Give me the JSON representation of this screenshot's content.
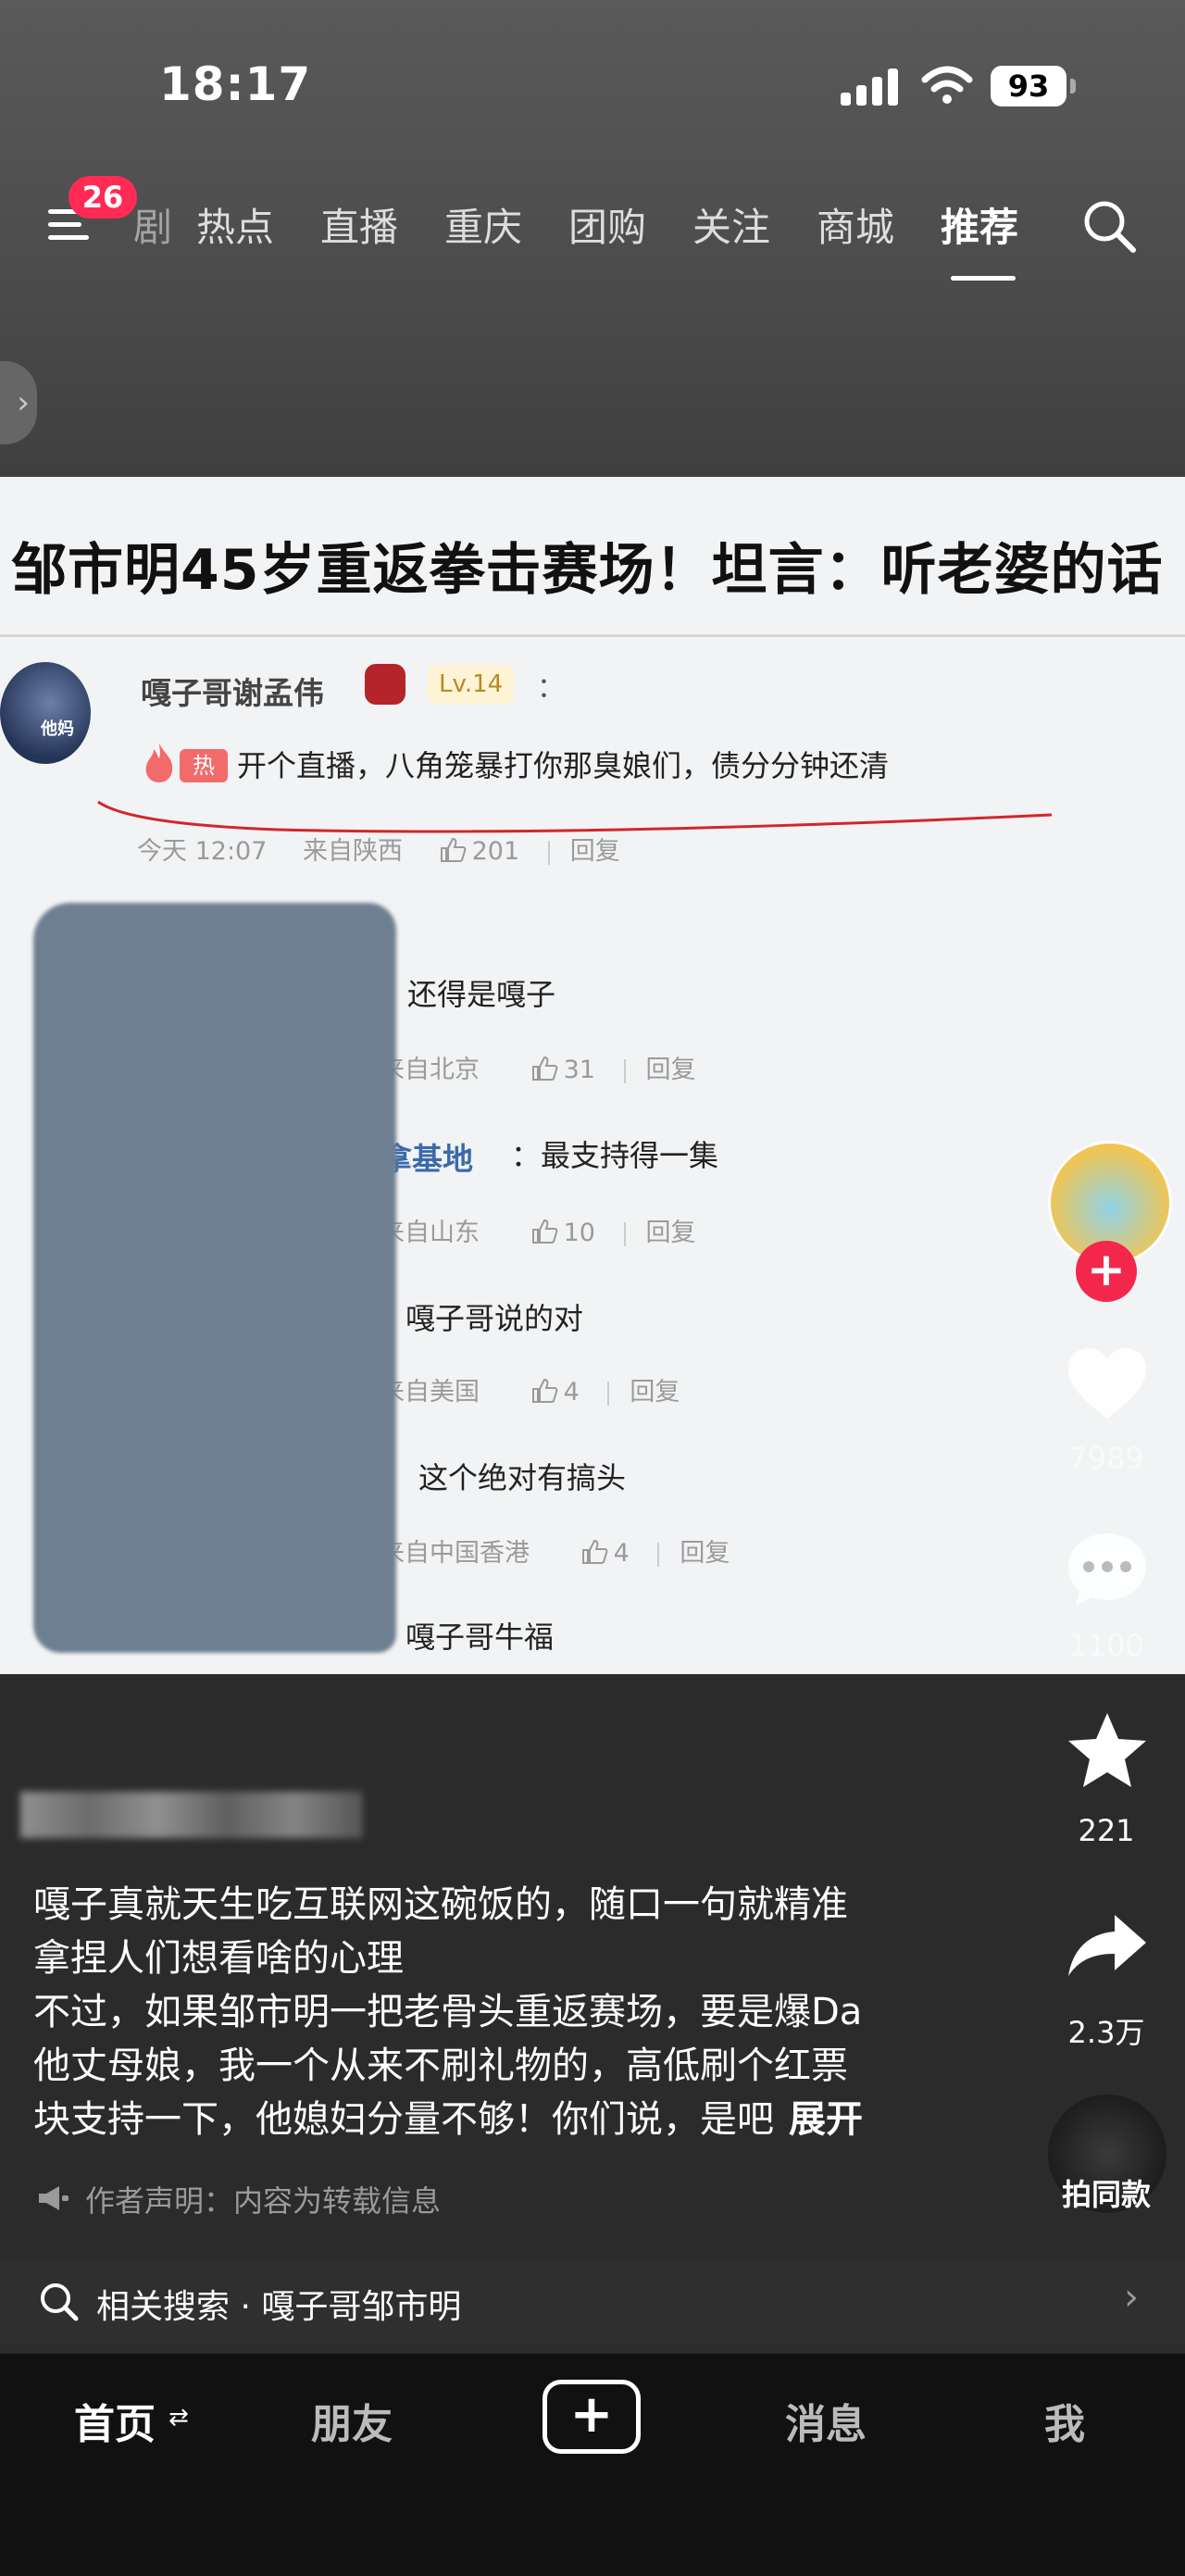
{
  "status_bar": {
    "time": "18:17",
    "battery": "93"
  },
  "top_nav": {
    "badge_count": "26",
    "tabs": [
      {
        "label": "剧"
      },
      {
        "label": "热点"
      },
      {
        "label": "直播"
      },
      {
        "label": "重庆"
      },
      {
        "label": "团购"
      },
      {
        "label": "关注"
      },
      {
        "label": "商城"
      },
      {
        "label": "推荐"
      }
    ]
  },
  "video": {
    "headline": "邹市明45岁重返拳击赛场！坦言：听老婆的话",
    "top_comment": {
      "avatar_text": "他妈",
      "user": "嘎子哥谢孟伟",
      "level": "Lv.14",
      "colon": "：",
      "hot_tag": "热",
      "text": "开个直播，八角笼暴打你那臭娘们，债分分钟还清",
      "time": "今天 12:07",
      "location": "来自陕西",
      "likes": "201",
      "reply": "回复"
    },
    "replies": [
      {
        "name": "",
        "text": "：还得是嘎子",
        "location": "来自北京",
        "likes": "31",
        "reply": "回复"
      },
      {
        "name": "拿基地",
        "text": "：最支持得一集",
        "location": "来自山东",
        "likes": "10",
        "reply": "回复"
      },
      {
        "name": "",
        "text": "：嘎子哥说的对",
        "location": "来自美国",
        "likes": "4",
        "reply": "回复"
      },
      {
        "name": "",
        "text": "这个绝对有搞头",
        "location": "来自中国香港",
        "likes": "4",
        "reply": "回复"
      },
      {
        "name": "",
        "text": "：嘎子哥牛福"
      }
    ]
  },
  "side_actions": {
    "likes": "7989",
    "comments": "1100",
    "favorites": "221",
    "shares": "2.3万",
    "same_style": "拍同款"
  },
  "caption": {
    "lines": [
      "嘎子真就天生吃互联网这碗饭的，随口一句就精准",
      "拿捏人们想看啥的心理",
      "不过，如果邹市明一把老骨头重返赛场，要是爆Da",
      "他丈母娘，我一个从来不刷礼物的，高低刷个红票",
      "块支持一下，他媳妇分量不够！你们说，是吧"
    ],
    "expand": "展开",
    "declaration": "作者声明：内容为转载信息"
  },
  "related_search": {
    "label": "相关搜索 · 嘎子哥邹市明"
  },
  "bottom_nav": {
    "home": "首页",
    "friends": "朋友",
    "add": "+",
    "messages": "消息",
    "me": "我"
  },
  "colors": {
    "accent_red": "#ff2b55",
    "link_blue": "#3c6aa8",
    "hot_tag": "#f26b6b"
  }
}
